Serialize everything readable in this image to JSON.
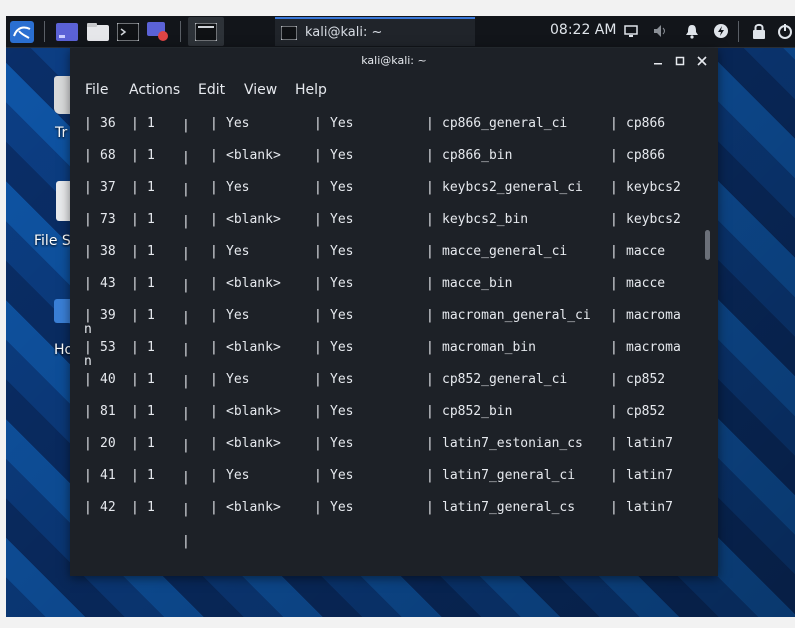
{
  "taskbar": {
    "task_title": "kali@kali: ~",
    "clock": "08:22 AM"
  },
  "desktop": {
    "icons": [
      {
        "label": "Tr"
      },
      {
        "label": "File S"
      },
      {
        "label": "Ho"
      }
    ]
  },
  "terminal": {
    "title": "kali@kali: ~",
    "menu": [
      "File",
      "Actions",
      "Edit",
      "View",
      "Help"
    ],
    "rows": [
      {
        "id": "36",
        "sortlen": "1",
        "compiled": "Yes",
        "default": "Yes",
        "collation": "cp866_general_ci",
        "charset": "cp866"
      },
      {
        "id": "68",
        "sortlen": "1",
        "compiled": "<blank>",
        "default": "Yes",
        "collation": "cp866_bin",
        "charset": "cp866"
      },
      {
        "id": "37",
        "sortlen": "1",
        "compiled": "Yes",
        "default": "Yes",
        "collation": "keybcs2_general_ci",
        "charset": "keybcs2"
      },
      {
        "id": "73",
        "sortlen": "1",
        "compiled": "<blank>",
        "default": "Yes",
        "collation": "keybcs2_bin",
        "charset": "keybcs2"
      },
      {
        "id": "38",
        "sortlen": "1",
        "compiled": "Yes",
        "default": "Yes",
        "collation": "macce_general_ci",
        "charset": "macce"
      },
      {
        "id": "43",
        "sortlen": "1",
        "compiled": "<blank>",
        "default": "Yes",
        "collation": "macce_bin",
        "charset": "macce"
      },
      {
        "id": "39",
        "sortlen": "1",
        "compiled": "Yes",
        "default": "Yes",
        "collation": "macroman_general_ci",
        "charset": "macroma"
      },
      {
        "id": "53",
        "sortlen": "1",
        "compiled": "<blank>",
        "default": "Yes",
        "collation": "macroman_bin",
        "charset": "macroma"
      },
      {
        "id": "40",
        "sortlen": "1",
        "compiled": "Yes",
        "default": "Yes",
        "collation": "cp852_general_ci",
        "charset": "cp852"
      },
      {
        "id": "81",
        "sortlen": "1",
        "compiled": "<blank>",
        "default": "Yes",
        "collation": "cp852_bin",
        "charset": "cp852"
      },
      {
        "id": "20",
        "sortlen": "1",
        "compiled": "<blank>",
        "default": "Yes",
        "collation": "latin7_estonian_cs",
        "charset": "latin7"
      },
      {
        "id": "41",
        "sortlen": "1",
        "compiled": "Yes",
        "default": "Yes",
        "collation": "latin7_general_ci",
        "charset": "latin7"
      },
      {
        "id": "42",
        "sortlen": "1",
        "compiled": "<blank>",
        "default": "Yes",
        "collation": "latin7_general_cs",
        "charset": "latin7"
      }
    ],
    "pipe": "|",
    "wrap_chars": [
      "n",
      "n"
    ]
  },
  "icons": {
    "kali_menu": "kali-dragon-icon",
    "workspace": "workspace-icon",
    "files": "file-manager-icon",
    "terminal": "terminal-icon",
    "recorder": "screen-recorder-icon"
  }
}
